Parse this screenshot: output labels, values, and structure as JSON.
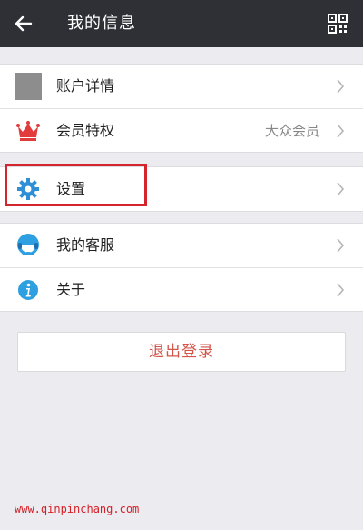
{
  "header": {
    "title": "我的信息",
    "back_icon": "arrow-left-icon",
    "qr_icon": "qr-code-icon"
  },
  "groups": [
    {
      "items": [
        {
          "label": "账户详情",
          "icon": "avatar-placeholder-icon",
          "value": ""
        },
        {
          "label": "会员特权",
          "icon": "crown-icon",
          "value": "大众会员"
        }
      ]
    },
    {
      "items": [
        {
          "label": "设置",
          "icon": "gear-icon",
          "value": ""
        }
      ]
    },
    {
      "items": [
        {
          "label": "我的客服",
          "icon": "customer-service-icon",
          "value": ""
        },
        {
          "label": "关于",
          "icon": "info-icon",
          "value": ""
        }
      ]
    }
  ],
  "logout": {
    "label": "退出登录"
  },
  "watermark": "www.qinpinchang.com",
  "colors": {
    "header_bg": "#2e3036",
    "page_bg": "#ebebf0",
    "highlight": "#d4252f",
    "logout_text": "#d2564a",
    "crown": "#e23b3b",
    "gear": "#2e8fd6",
    "info": "#2e9fe0"
  }
}
